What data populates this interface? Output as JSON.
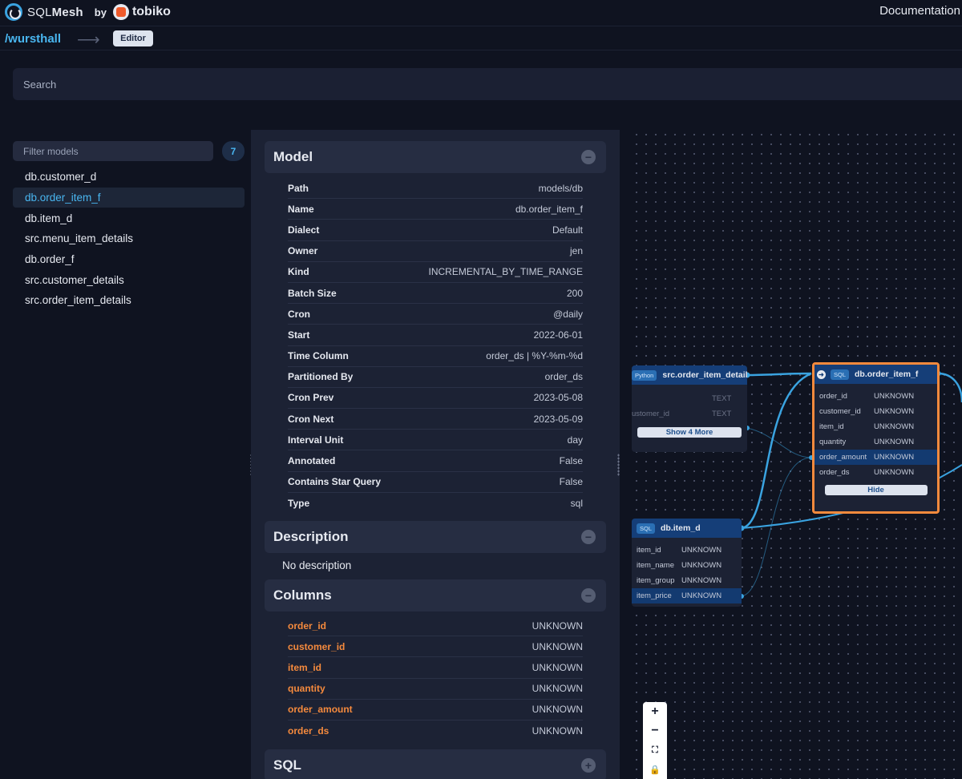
{
  "header": {
    "brand_light": "SQL",
    "brand_bold": "Mesh",
    "by": "by",
    "company": "tobiko",
    "documentation": "Documentation"
  },
  "pathbar": {
    "project": "/wursthall",
    "arrow": "⟶",
    "editor": "Editor"
  },
  "search": {
    "placeholder": "Search"
  },
  "sidebar": {
    "filter_placeholder": "Filter models",
    "count": "7",
    "models": [
      "db.customer_d",
      "db.order_item_f",
      "db.item_d",
      "src.menu_item_details",
      "db.order_f",
      "src.customer_details",
      "src.order_item_details"
    ],
    "active_index": 1
  },
  "model": {
    "title": "Model",
    "props": [
      {
        "k": "Path",
        "v": "models/db"
      },
      {
        "k": "Name",
        "v": "db.order_item_f"
      },
      {
        "k": "Dialect",
        "v": "Default"
      },
      {
        "k": "Owner",
        "v": "jen"
      },
      {
        "k": "Kind",
        "v": "INCREMENTAL_BY_TIME_RANGE"
      },
      {
        "k": "Batch Size",
        "v": "200"
      },
      {
        "k": "Cron",
        "v": "@daily"
      },
      {
        "k": "Start",
        "v": "2022-06-01"
      },
      {
        "k": "Time Column",
        "v": "order_ds | %Y-%m-%d"
      },
      {
        "k": "Partitioned By",
        "v": "order_ds"
      },
      {
        "k": "Cron Prev",
        "v": "2023-05-08"
      },
      {
        "k": "Cron Next",
        "v": "2023-05-09"
      },
      {
        "k": "Interval Unit",
        "v": "day"
      },
      {
        "k": "Annotated",
        "v": "False"
      },
      {
        "k": "Contains Star Query",
        "v": "False"
      },
      {
        "k": "Type",
        "v": "sql"
      }
    ]
  },
  "description": {
    "title": "Description",
    "text": "No description"
  },
  "columns": {
    "title": "Columns",
    "rows": [
      {
        "k": "order_id",
        "v": "UNKNOWN"
      },
      {
        "k": "customer_id",
        "v": "UNKNOWN"
      },
      {
        "k": "item_id",
        "v": "UNKNOWN"
      },
      {
        "k": "quantity",
        "v": "UNKNOWN"
      },
      {
        "k": "order_amount",
        "v": "UNKNOWN"
      },
      {
        "k": "order_ds",
        "v": "UNKNOWN"
      }
    ]
  },
  "sql": {
    "title": "SQL"
  },
  "graph": {
    "src_node": {
      "tag": "Python",
      "name": "src.order_item_details",
      "rows": [
        {
          "c1": "",
          "c2": "TEXT"
        },
        {
          "c1": "ustomer_id",
          "c2": "TEXT"
        }
      ],
      "button": "Show 4 More"
    },
    "main_node": {
      "tag": "SQL",
      "name": "db.order_item_f",
      "rows": [
        {
          "c1": "order_id",
          "c2": "UNKNOWN"
        },
        {
          "c1": "customer_id",
          "c2": "UNKNOWN"
        },
        {
          "c1": "item_id",
          "c2": "UNKNOWN"
        },
        {
          "c1": "quantity",
          "c2": "UNKNOWN"
        },
        {
          "c1": "order_amount",
          "c2": "UNKNOWN"
        },
        {
          "c1": "order_ds",
          "c2": "UNKNOWN"
        }
      ],
      "highlight_index": 4,
      "button": "Hide",
      "border_color": "#f58a3d"
    },
    "item_node": {
      "tag": "SQL",
      "name": "db.item_d",
      "rows": [
        {
          "c1": "item_id",
          "c2": "UNKNOWN"
        },
        {
          "c1": "item_name",
          "c2": "UNKNOWN"
        },
        {
          "c1": "item_group",
          "c2": "UNKNOWN"
        },
        {
          "c1": "item_price",
          "c2": "UNKNOWN"
        }
      ],
      "highlight_index": 3
    },
    "edge_color": "#3aa3e0",
    "zoom_controls": [
      {
        "name": "zoom-in-icon",
        "glyph": "+"
      },
      {
        "name": "zoom-out-icon",
        "glyph": "−"
      },
      {
        "name": "fit-view-icon",
        "glyph": "⛶"
      },
      {
        "name": "lock-icon",
        "glyph": "🔒"
      }
    ]
  }
}
